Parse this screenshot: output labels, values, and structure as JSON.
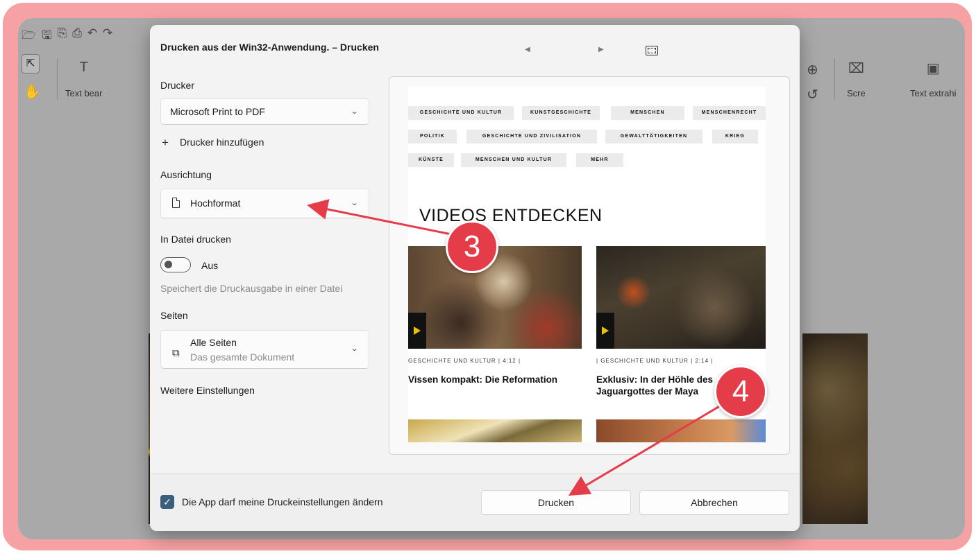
{
  "toolbar": {
    "quick_icons": [
      "open-icon",
      "save-icon",
      "save-as-icon",
      "print-icon",
      "undo-icon",
      "redo-icon"
    ],
    "text_tool_label": "Text bear",
    "right_tools": [
      {
        "label": "Scre",
        "icon": "screenshot-icon"
      },
      {
        "label": "Text extrahi",
        "icon": "text-extract-icon"
      }
    ]
  },
  "dialog": {
    "title": "Drucken aus der Win32-Anwendung. – Drucken",
    "printer_label": "Drucker",
    "printer_value": "Microsoft Print to PDF",
    "add_printer": "Drucker hinzufügen",
    "orientation_label": "Ausrichtung",
    "orientation_value": "Hochformat",
    "print_to_file_label": "In Datei drucken",
    "print_to_file_state": "Aus",
    "print_to_file_hint": "Speichert die Druckausgabe in einer Datei",
    "pages_label": "Seiten",
    "pages_value": "Alle Seiten",
    "pages_sub": "Das gesamte Dokument",
    "more_settings": "Weitere Einstellungen",
    "allow_app_label": "Die App darf meine Druckeinstellungen ändern",
    "print_button": "Drucken",
    "cancel_button": "Abbrechen"
  },
  "preview": {
    "tags": [
      "GESCHICHTE UND KULTUR",
      "KUNSTGESCHICHTE",
      "MENSCHEN",
      "MENSCHENRECHT",
      "POLITIK",
      "GESCHICHTE UND ZIVILISATION",
      "GEWALTTÄTIGKEITEN",
      "KRIEG",
      "KÜNSTE",
      "MENSCHEN UND KULTUR",
      "MEHR"
    ],
    "heading": "VIDEOS ENTDECKEN",
    "videos": [
      {
        "meta": "GESCHICHTE UND KULTUR  |  4:12  |",
        "title": "Vissen kompakt: Die Reformation"
      },
      {
        "meta": "|  GESCHICHTE UND KULTUR  |  2:14  |",
        "title": "Exklusiv: In der Höhle des Jaguargottes der Maya"
      }
    ]
  },
  "annotations": {
    "step3": "3",
    "step4": "4",
    "color": "#e53c4a"
  }
}
